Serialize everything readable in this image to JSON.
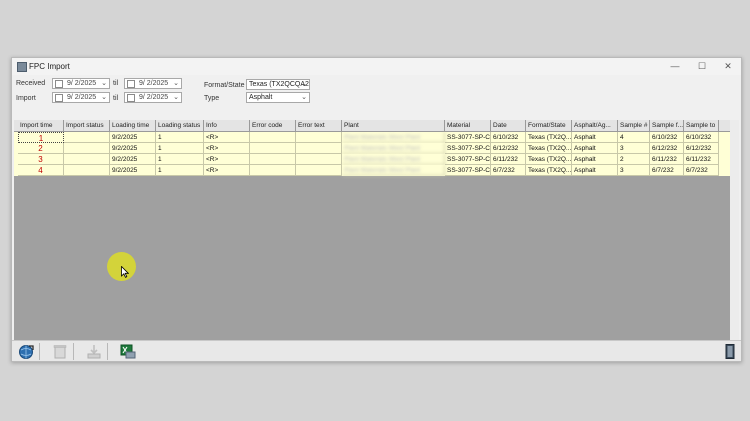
{
  "window": {
    "title": "FPC Import",
    "minimize": "—",
    "maximize": "☐",
    "close": "✕"
  },
  "filters": {
    "received_label": "Received",
    "import_label": "Import",
    "til_label": "til",
    "received_from": "9/ 2/2025",
    "received_to": "9/ 2/2025",
    "import_from": "9/ 2/2025",
    "import_to": "9/ 2/2025",
    "format_state_label": "Format/State",
    "format_state_value": "Texas (TX2QCQA2",
    "type_label": "Type",
    "type_value": "Asphalt"
  },
  "grid": {
    "columns": [
      "Import time",
      "Import status",
      "Loading time",
      "Loading status",
      "Info",
      "Error code",
      "Error text",
      "Plant",
      "Material",
      "Date",
      "Format/State",
      "Asphalt/Ag...",
      "Sample #",
      "Sample f...",
      "Sample to"
    ],
    "rows": [
      {
        "num": "1",
        "loading_time": "9/2/2025",
        "loading_status": "1",
        "info": "<R>",
        "plant": "Plant Materials West Plant",
        "material": "SS-3077-SP-C",
        "date": "6/10/232",
        "format_state": "Texas (TX2Q...",
        "asphalt": "Asphalt",
        "sample_num": "4",
        "sample_from": "6/10/232",
        "sample_to": "6/10/232"
      },
      {
        "num": "2",
        "loading_time": "9/2/2025",
        "loading_status": "1",
        "info": "<R>",
        "plant": "Plant Materials West Plant",
        "material": "SS-3077-SP-C",
        "date": "6/12/232",
        "format_state": "Texas (TX2Q...",
        "asphalt": "Asphalt",
        "sample_num": "3",
        "sample_from": "6/12/232",
        "sample_to": "6/12/232"
      },
      {
        "num": "3",
        "loading_time": "9/2/2025",
        "loading_status": "1",
        "info": "<R>",
        "plant": "Plant Materials West Plant",
        "material": "SS-3077-SP-C",
        "date": "6/11/232",
        "format_state": "Texas (TX2Q...",
        "asphalt": "Asphalt",
        "sample_num": "2",
        "sample_from": "6/11/232",
        "sample_to": "6/11/232"
      },
      {
        "num": "4",
        "loading_time": "9/2/2025",
        "loading_status": "1",
        "info": "<R>",
        "plant": "Plant Materials West Plant",
        "material": "SS-3077-SP-C",
        "date": "6/7/232",
        "format_state": "Texas (TX2Q...",
        "asphalt": "Asphalt",
        "sample_num": "3",
        "sample_from": "6/7/232",
        "sample_to": "6/7/232"
      }
    ]
  },
  "toolbar": {
    "icons": [
      "refresh-globe-icon",
      "delete-icon",
      "import-icon",
      "excel-export-icon",
      "exit-door-icon"
    ]
  },
  "colors": {
    "row_bg": "#ffffd6",
    "row_num": "#c00000",
    "grid_bg": "#a0a0a0"
  }
}
